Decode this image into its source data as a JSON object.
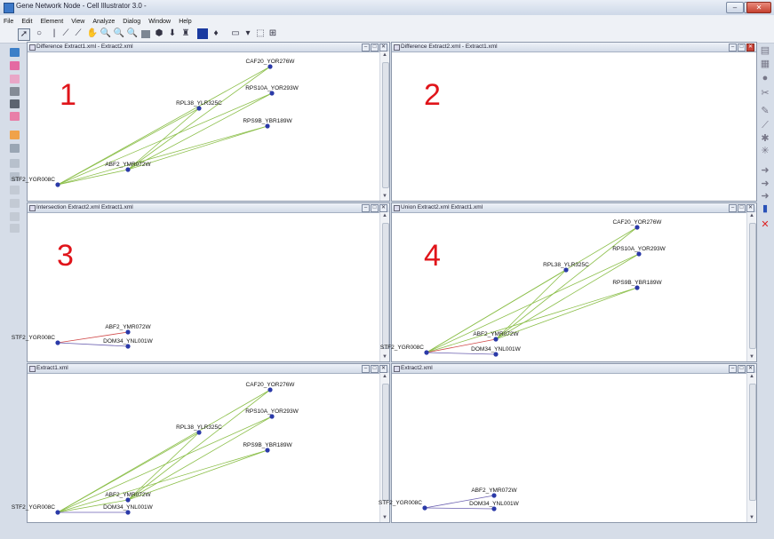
{
  "window": {
    "title": "Gene Network Node - Cell Illustrator 3.0 -",
    "controls": [
      "–",
      "□",
      "✕"
    ]
  },
  "menu": [
    "File",
    "Edit",
    "Element",
    "View",
    "Analyze",
    "Dialog",
    "Window",
    "Help"
  ],
  "toolbar_icons": [
    "pointer-icon",
    "place-icon",
    "process-icon",
    "connector-icon",
    "connector-alt-icon",
    "hand-icon",
    "zoom-in-icon",
    "zoom-out-icon",
    "zoom-fit-icon",
    "grid-icon",
    "hexagon-icon",
    "bucket-icon",
    "person-icon",
    "color-square-icon",
    "arrow-down-icon",
    "line-style-icon",
    "dropdown-icon",
    "frame-icon",
    "table-icon"
  ],
  "panels": [
    {
      "id": "p1",
      "title": "Difference Extract1.xml - Extract2.xml",
      "number": "1",
      "nodes": [
        {
          "id": "CAF20",
          "label": "CAF20_YOR276W"
        },
        {
          "id": "RPS10A",
          "label": "RPS10A_YOR293W"
        },
        {
          "id": "RPL3B",
          "label": "RPL38_YLR325C"
        },
        {
          "id": "RPS9B",
          "label": "RPS9B_YBR189W"
        },
        {
          "id": "ABF2",
          "label": "ABF2_YMR072W"
        },
        {
          "id": "STF2",
          "label": "STF2_YGR008C"
        }
      ],
      "edges": [
        [
          "STF2",
          "CAF20",
          "g"
        ],
        [
          "STF2",
          "RPS10A",
          "g"
        ],
        [
          "STF2",
          "RPL3B",
          "g"
        ],
        [
          "STF2",
          "RPS9B",
          "g"
        ],
        [
          "ABF2",
          "CAF20",
          "g"
        ],
        [
          "ABF2",
          "RPS10A",
          "g"
        ],
        [
          "ABF2",
          "RPL3B",
          "g"
        ],
        [
          "ABF2",
          "RPS9B",
          "g"
        ],
        [
          "STF2",
          "ABF2",
          "g"
        ]
      ]
    },
    {
      "id": "p2",
      "title": "Difference Extract2.xml - Extract1.xml",
      "number": "2",
      "nodes": [],
      "edges": []
    },
    {
      "id": "p3",
      "title": "Intersection Extract2.xml Extract1.xml",
      "number": "3",
      "nodes": [
        {
          "id": "ABF2",
          "label": "ABF2_YMR072W"
        },
        {
          "id": "STF2",
          "label": "STF2_YGR008C"
        },
        {
          "id": "DOM34",
          "label": "DOM34_YNL001W"
        }
      ],
      "edges": [
        [
          "STF2",
          "ABF2",
          "r"
        ],
        [
          "STF2",
          "DOM34",
          "p"
        ]
      ]
    },
    {
      "id": "p4",
      "title": "Union Extract2.xml Extract1.xml",
      "number": "4",
      "nodes": [
        {
          "id": "CAF20",
          "label": "CAF20_YOR276W"
        },
        {
          "id": "RPS10A",
          "label": "RPS10A_YOR293W"
        },
        {
          "id": "RPL3B",
          "label": "RPL38_YLR325C"
        },
        {
          "id": "RPS9B",
          "label": "RPS9B_YBR189W"
        },
        {
          "id": "ABF2",
          "label": "ABF2_YMR072W"
        },
        {
          "id": "STF2",
          "label": "STF2_YGR008C"
        },
        {
          "id": "DOM34",
          "label": "DOM34_YNL001W"
        }
      ],
      "edges": [
        [
          "STF2",
          "CAF20",
          "g"
        ],
        [
          "STF2",
          "RPS10A",
          "g"
        ],
        [
          "STF2",
          "RPL3B",
          "g"
        ],
        [
          "STF2",
          "RPS9B",
          "g"
        ],
        [
          "ABF2",
          "CAF20",
          "g"
        ],
        [
          "ABF2",
          "RPS10A",
          "g"
        ],
        [
          "ABF2",
          "RPL3B",
          "g"
        ],
        [
          "ABF2",
          "RPS9B",
          "g"
        ],
        [
          "STF2",
          "ABF2",
          "r"
        ],
        [
          "STF2",
          "DOM34",
          "p"
        ]
      ]
    },
    {
      "id": "p5",
      "title": "Extract1.xml",
      "number": "",
      "nodes": [
        {
          "id": "CAF20",
          "label": "CAF20_YOR276W"
        },
        {
          "id": "RPS10A",
          "label": "RPS10A_YOR293W"
        },
        {
          "id": "RPL3B",
          "label": "RPL38_YLR325C"
        },
        {
          "id": "RPS9B",
          "label": "RPS9B_YBR189W"
        },
        {
          "id": "ABF2",
          "label": "ABF2_YMR072W"
        },
        {
          "id": "STF2",
          "label": "STF2_YGR008C"
        },
        {
          "id": "DOM34",
          "label": "DOM34_YNL001W"
        }
      ],
      "edges": [
        [
          "STF2",
          "CAF20",
          "g"
        ],
        [
          "STF2",
          "RPS10A",
          "g"
        ],
        [
          "STF2",
          "RPL3B",
          "g"
        ],
        [
          "STF2",
          "RPS9B",
          "g"
        ],
        [
          "ABF2",
          "CAF20",
          "g"
        ],
        [
          "ABF2",
          "RPS10A",
          "g"
        ],
        [
          "ABF2",
          "RPL3B",
          "g"
        ],
        [
          "ABF2",
          "RPS9B",
          "g"
        ],
        [
          "STF2",
          "ABF2",
          "g"
        ],
        [
          "STF2",
          "DOM34",
          "p"
        ]
      ]
    },
    {
      "id": "p6",
      "title": "Extract2.xml",
      "number": "",
      "nodes": [
        {
          "id": "ABF2",
          "label": "ABF2_YMR072W"
        },
        {
          "id": "STF2",
          "label": "STF2_YGR008C"
        },
        {
          "id": "DOM34",
          "label": "DOM34_YNL001W"
        }
      ],
      "edges": [
        [
          "STF2",
          "ABF2",
          "p"
        ],
        [
          "STF2",
          "DOM34",
          "p"
        ]
      ]
    }
  ],
  "colors": {
    "node": "#2b3aa8",
    "edge_green": "#8cbf4a",
    "edge_red": "#d04848",
    "edge_purple": "#6a5fb0",
    "number": "#e0141a"
  }
}
